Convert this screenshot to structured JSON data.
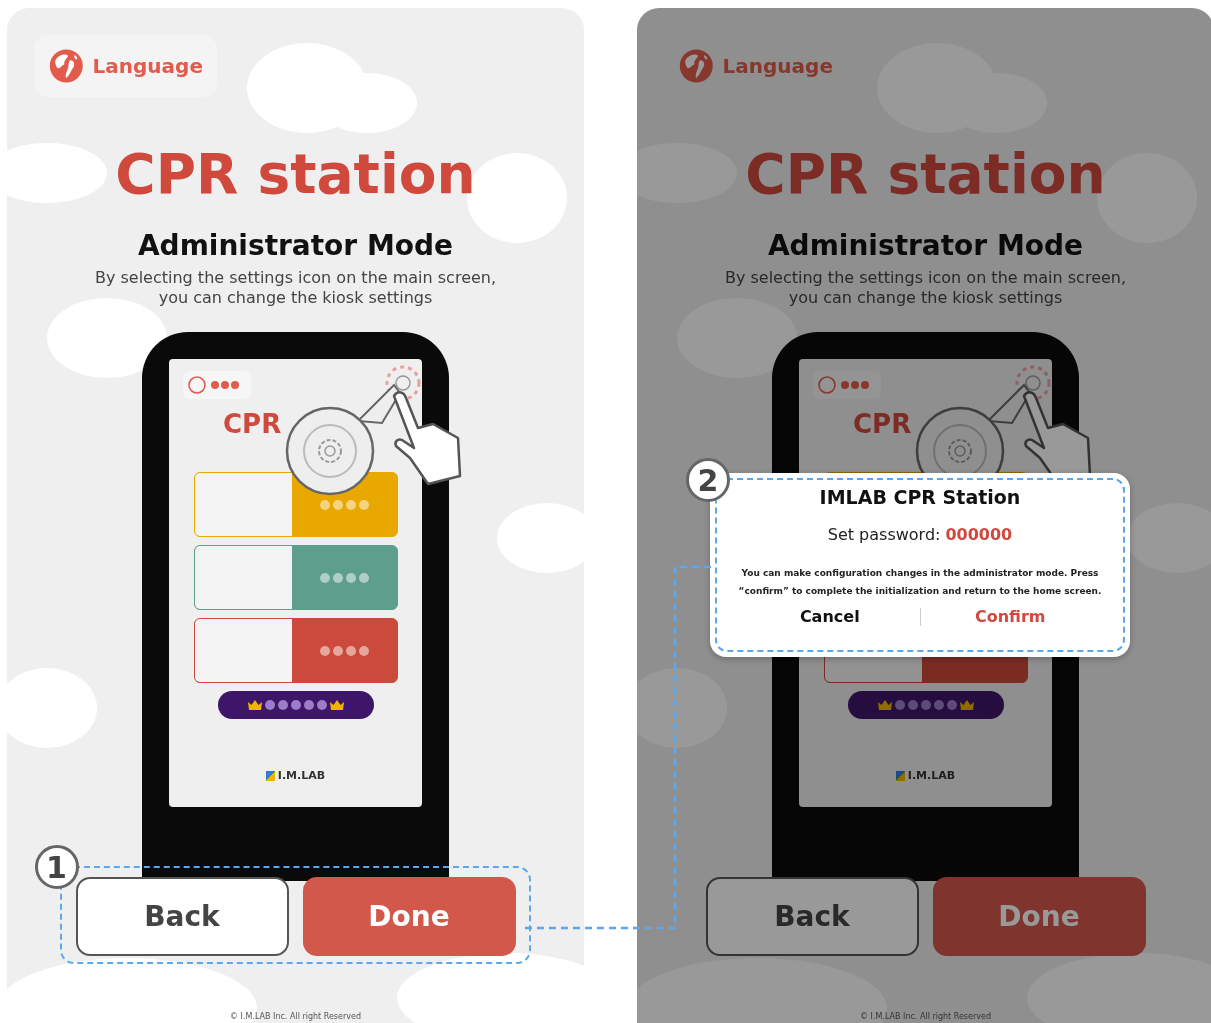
{
  "panels": [
    {
      "dimmed": false,
      "button_step": "1",
      "language": "Language",
      "title": "CPR station",
      "heading": "Administrator Mode",
      "description": [
        "By selecting the settings icon on the main screen,",
        "you can change the kiosk settings"
      ],
      "kiosk": {
        "title": "CPR",
        "logo": "I.M.LAB"
      },
      "buttons": [
        {
          "label": "Back",
          "kind": "secondary"
        },
        {
          "label": "Done",
          "kind": "primary"
        }
      ],
      "footer": "© I.M.LAB Inc. All right Reserved"
    },
    {
      "dimmed": true,
      "language": "Language",
      "title": "CPR station",
      "heading": "Administrator Mode",
      "description": [
        "By selecting the settings icon on the main screen,",
        "you can change the kiosk settings"
      ],
      "kiosk": {
        "title": "CPR",
        "logo": "I.M.LAB"
      },
      "buttons": [
        {
          "label": "Back",
          "kind": "secondary"
        },
        {
          "label": "Done",
          "kind": "primary"
        }
      ],
      "footer": "© I.M.LAB Inc. All right Reserved",
      "dialog": {
        "step": "2",
        "title": "IMLAB CPR Station",
        "password_label": "Set password:",
        "password": "000000",
        "message": "You can make configuration changes in the administrator mode. Press “confirm” to complete the initialization and return to the home screen.",
        "actions": [
          {
            "label": "Cancel",
            "kind": "cancel"
          },
          {
            "label": "Confirm",
            "kind": "confirm"
          }
        ]
      }
    }
  ]
}
